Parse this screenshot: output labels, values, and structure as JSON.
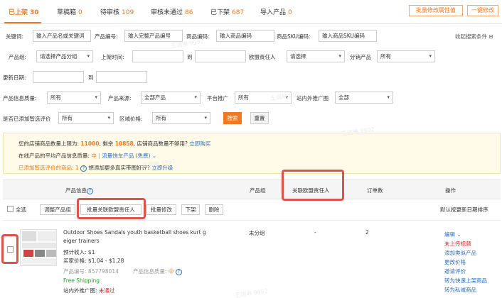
{
  "tabs": [
    {
      "label": "已上架",
      "count": "30"
    },
    {
      "label": "草稿箱",
      "count": "0"
    },
    {
      "label": "待审核",
      "count": "109"
    },
    {
      "label": "审核未通过",
      "count": "86"
    },
    {
      "label": "已下架",
      "count": "687"
    },
    {
      "label": "导入产品",
      "count": "0"
    }
  ],
  "header_buttons": {
    "batch_attr": "批量修改属性值",
    "one_click": "一键修改"
  },
  "filters": {
    "keyword_label": "关键词:",
    "keyword_placeholder": "输入产品名或关键词",
    "product_no_label": "产品编号:",
    "product_no_placeholder": "输入完整产品编号",
    "sku_code_label": "商品编码:",
    "sku_code_placeholder": "输入商品编码",
    "sku_sku_label": "商品SKU编码:",
    "sku_sku_placeholder": "输入商品SKU编码",
    "collapse": "收起搜索条件",
    "collapse_icon": "⊟",
    "group_label": "产品组:",
    "group_value": "请选择产品分组",
    "listed_label": "上架时间:",
    "to1": "到",
    "owner_label": "欧盟责任人",
    "owner_value": "请选择",
    "dist_label": "分销产品",
    "dist_value": "所有",
    "update_label": "更新日期:",
    "to2": "到",
    "quality_label": "产品信息质量:",
    "quality_value": "所有",
    "source_label": "产品来源:",
    "source_value": "全部产品",
    "platform_label": "平台推广",
    "platform_value": "所有",
    "ads_label": "站内外推广图",
    "ads_value": "全部",
    "review_label": "是否已添加智选评价",
    "review_value": "所有",
    "price_label": "区域价格:",
    "price_value": "所有",
    "search_btn": "搜索",
    "reset_btn": "重置"
  },
  "notice": {
    "line1_a": "您的店铺商品数量上限为:",
    "limit": "11000",
    "line1_b": ", 剩余",
    "remain": "10858",
    "line1_c": ", 店铺商品数量不够用?",
    "apply": "立即购买",
    "line2_a": "在线产品的平均产品信息质量:",
    "quality": "中",
    "sep": "|",
    "traffic": "流量快车产品 (免费)",
    "chev": "⌄",
    "line3_a": "已添加智选评价的商品:",
    "line3_count": "1",
    "line3_b": "想添加更多真实带图好评?",
    "upgrade": "立即升级"
  },
  "table": {
    "col_info": "产品信息",
    "col_group": "产品组",
    "col_owner": "关联欧盟责任人",
    "col_orders": "订单数",
    "col_ops": "操作",
    "select_all": "全选",
    "toolbar": [
      "调整产品组",
      "批量关联欧盟责任人",
      "批量修改",
      "下架",
      "删除"
    ],
    "sort": "默认按更新日期排序"
  },
  "row": {
    "title_l1": "Outdoor Shoes Sandals youth basketball shoes kurt g",
    "title_l2": "eiger trainers",
    "income_label": "预计收入:",
    "income": "$1",
    "price_label": "买家价格:",
    "price": "$1.04 - $1.28",
    "pid_label": "产品编号:",
    "pid": "857798014",
    "quality_label": "产品信息质量:",
    "quality": "中",
    "shipping": "Free Shipping",
    "ads_label": "站内外推广图:",
    "ads_status": "未通过",
    "group": "未分组",
    "owner": "-",
    "orders": "2",
    "actions": [
      "编辑 ⌄",
      "未上传视频",
      "添加类似产品",
      "更改价格",
      "邀请评价",
      "转为快速上架商品",
      "转为私域商品"
    ]
  },
  "watermark": "王瑞琳 9992"
}
